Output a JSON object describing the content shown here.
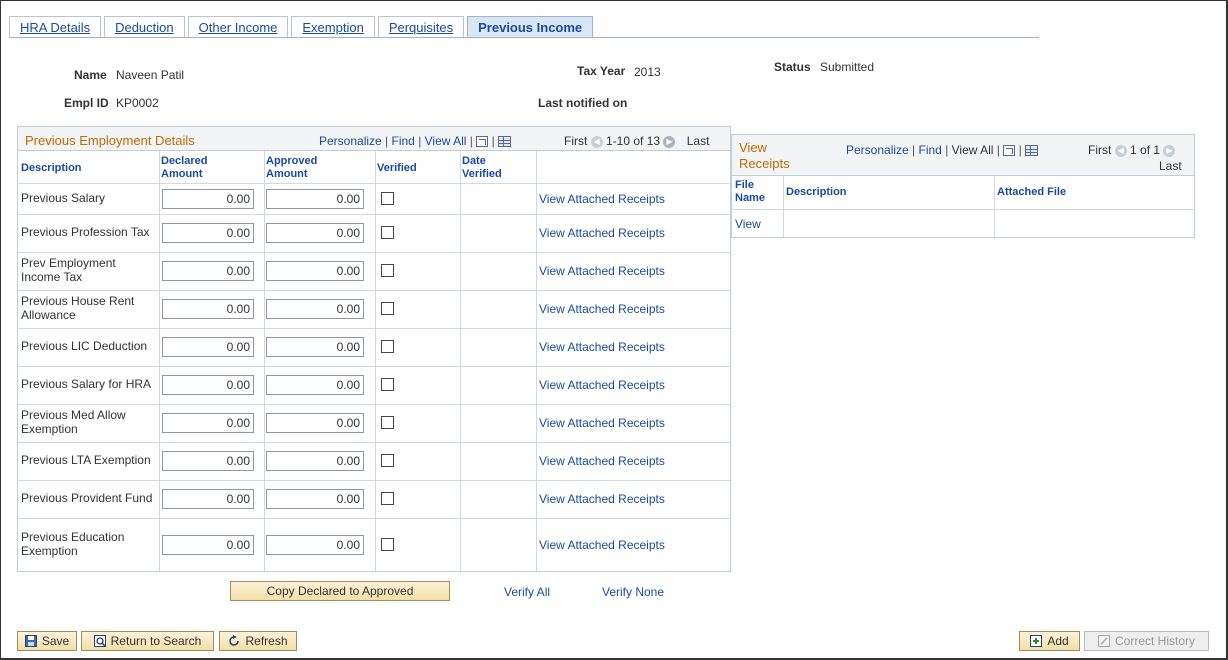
{
  "tabs": [
    {
      "label": "HRA Details",
      "active": false
    },
    {
      "label": "Deduction",
      "active": false
    },
    {
      "label": "Other Income",
      "active": false
    },
    {
      "label": "Exemption",
      "active": false
    },
    {
      "label": "Perquisites",
      "active": false
    },
    {
      "label": "Previous Income",
      "active": true
    }
  ],
  "header": {
    "name_label": "Name",
    "name_value": "Naveen Patil",
    "emplid_label": "Empl ID",
    "emplid_value": "KP0002",
    "taxyear_label": "Tax Year",
    "taxyear_value": "2013",
    "status_label": "Status",
    "status_value": "Submitted",
    "lastnotified_label": "Last notified on"
  },
  "prev_grid": {
    "title": "Previous Employment Details",
    "personalize": "Personalize",
    "find": "Find",
    "viewall": "View All",
    "first": "First",
    "range": "1-10 of 13",
    "last": "Last",
    "columns": {
      "description": "Description",
      "declared1": "Declared",
      "declared2": "Amount",
      "approved1": "Approved",
      "approved2": "Amount",
      "verified": "Verified",
      "date1": "Date",
      "date2": "Verified"
    },
    "rows": [
      {
        "desc1": "Previous Salary",
        "desc2": "",
        "declared": "0.00",
        "approved": "0.00",
        "link": "View Attached Receipts"
      },
      {
        "desc1": "Previous Profession Tax",
        "desc2": "",
        "declared": "0.00",
        "approved": "0.00",
        "link": "View Attached Receipts"
      },
      {
        "desc1": "Prev Employment",
        "desc2": "Income Tax",
        "declared": "0.00",
        "approved": "0.00",
        "link": "View Attached Receipts"
      },
      {
        "desc1": "Previous House Rent",
        "desc2": "Allowance",
        "declared": "0.00",
        "approved": "0.00",
        "link": "View Attached Receipts"
      },
      {
        "desc1": "Previous LIC Deduction",
        "desc2": "",
        "declared": "0.00",
        "approved": "0.00",
        "link": "View Attached Receipts"
      },
      {
        "desc1": "Previous Salary for HRA",
        "desc2": "",
        "declared": "0.00",
        "approved": "0.00",
        "link": "View Attached Receipts"
      },
      {
        "desc1": "Previous Med Allow",
        "desc2": "Exemption",
        "declared": "0.00",
        "approved": "0.00",
        "link": "View Attached Receipts"
      },
      {
        "desc1": "Previous LTA Exemption",
        "desc2": "",
        "declared": "0.00",
        "approved": "0.00",
        "link": "View Attached Receipts"
      },
      {
        "desc1": "Previous Provident Fund",
        "desc2": "",
        "declared": "0.00",
        "approved": "0.00",
        "link": "View Attached Receipts"
      },
      {
        "desc1": "Previous Education",
        "desc2": "Exemption",
        "declared": "0.00",
        "approved": "0.00",
        "link": "View Attached Receipts"
      }
    ]
  },
  "receipts_grid": {
    "title1": "View",
    "title2": "Receipts",
    "personalize": "Personalize",
    "find": "Find",
    "viewall": "View All",
    "first": "First",
    "range": "1 of 1",
    "last": "Last",
    "columns": {
      "filename1": "File",
      "filename2": "Name",
      "description": "Description",
      "attached": "Attached File"
    },
    "row": {
      "view": "View"
    }
  },
  "actions": {
    "copy": "Copy Declared to Approved",
    "verify_all": "Verify All",
    "verify_none": "Verify None"
  },
  "toolbar": {
    "save": "Save",
    "return": "Return to Search",
    "refresh": "Refresh",
    "add": "Add",
    "correct_history": "Correct History"
  }
}
